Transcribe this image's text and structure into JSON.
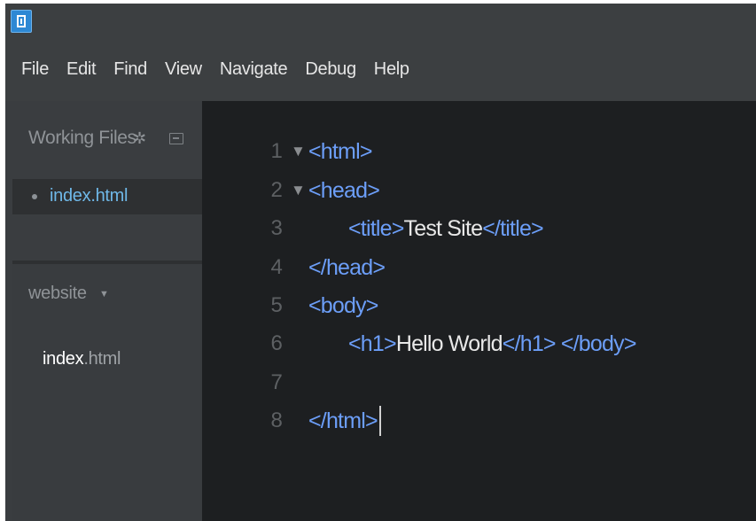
{
  "menu": [
    "File",
    "Edit",
    "Find",
    "View",
    "Navigate",
    "Debug",
    "Help"
  ],
  "sidebar": {
    "working_files_title": "Working Files",
    "working_file": "index.html",
    "project_name": "website",
    "project_file_base": "index",
    "project_file_ext": ".html"
  },
  "editor": {
    "lines": [
      {
        "num": "1",
        "fold": "▼",
        "parts": [
          {
            "c": "tag",
            "t": "<html>"
          }
        ]
      },
      {
        "num": "2",
        "fold": "▼",
        "parts": [
          {
            "c": "tag",
            "t": "<head>"
          }
        ]
      },
      {
        "num": "3",
        "fold": "",
        "parts": [
          {
            "c": "tag",
            "t": "<title>"
          },
          {
            "c": "txt",
            "t": "Test Site"
          },
          {
            "c": "tag",
            "t": "</title>"
          }
        ]
      },
      {
        "num": "4",
        "fold": "",
        "parts": [
          {
            "c": "tag",
            "t": "</head>"
          }
        ]
      },
      {
        "num": "5",
        "fold": "",
        "parts": [
          {
            "c": "tag",
            "t": "<body>"
          }
        ]
      },
      {
        "num": "6",
        "fold": "",
        "parts": [
          {
            "c": "tag",
            "t": "<h1>"
          },
          {
            "c": "txt",
            "t": "Hello World"
          },
          {
            "c": "tag",
            "t": "</h1> </body>"
          }
        ]
      },
      {
        "num": "7",
        "fold": "",
        "parts": []
      },
      {
        "num": "8",
        "fold": "",
        "parts": [
          {
            "c": "tag",
            "t": "</html>"
          }
        ]
      }
    ]
  },
  "colors": {
    "tag": "#6c9ef8",
    "text": "#e8e8e8",
    "active_file": "#6fb8e8",
    "editor_bg": "#1d1f21",
    "sidebar_bg": "#3a3d40"
  },
  "icons": {
    "app": "brackets-logo-icon",
    "gear": "gear-icon",
    "split": "split-view-icon",
    "fold": "fold-arrow-icon"
  }
}
